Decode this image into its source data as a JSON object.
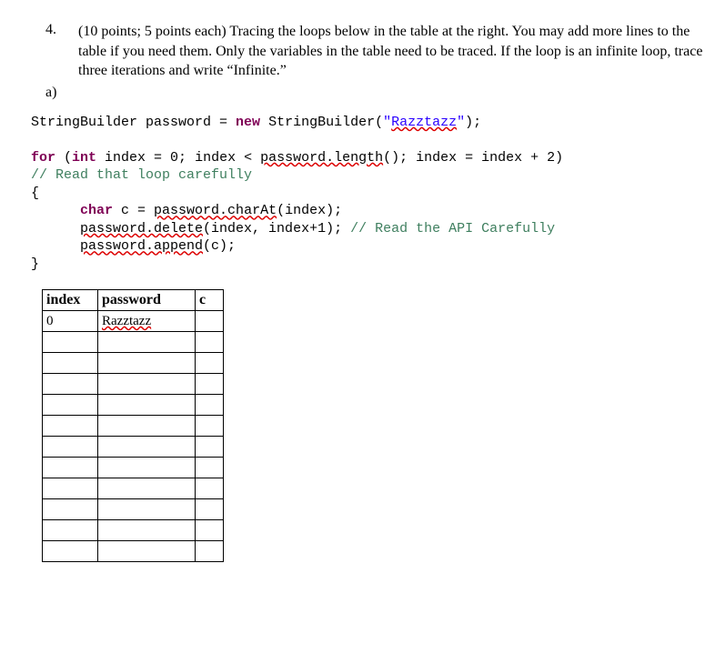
{
  "question": {
    "number": "4.",
    "prompt": "(10 points; 5 points each) Tracing the loops below in the table at the right. You may add more lines to the table if you need them.  Only the variables in the table need to be traced. If the loop is an infinite loop, trace three iterations and write “Infinite.”",
    "part": "a)"
  },
  "code": {
    "line1_a": "StringBuilder password = ",
    "line1_kw": "new",
    "line1_b": " StringBuilder(",
    "line1_str_open": "\"",
    "line1_str_text": "Razztazz",
    "line1_str_close": "\"",
    "line1_c": ");",
    "line2_kw1": "for",
    "line2_a": " (",
    "line2_kw2": "int",
    "line2_b": " index = 0; index < ",
    "line2_sq": "password.length",
    "line2_c": "(); index = index + 2)",
    "line3_cmnt": "// Read that loop carefully",
    "line4": "{",
    "line5_indent": "      ",
    "line5_kw": "char",
    "line5_a": " c = ",
    "line5_sq": "password.charAt",
    "line5_b": "(index);",
    "line6_indent": "      ",
    "line6_sq": "password.delete",
    "line6_a": "(index, index+1); ",
    "line6_cmnt": "// Read the API Carefully",
    "line7_indent": "      ",
    "line7_sq": "password.append",
    "line7_a": "(c);",
    "line8": "}"
  },
  "table": {
    "headers": {
      "index": "index",
      "password": "password",
      "c": "c"
    },
    "rows": [
      {
        "index": "0",
        "password": "Razztazz",
        "c": ""
      },
      {
        "index": "",
        "password": "",
        "c": ""
      },
      {
        "index": "",
        "password": "",
        "c": ""
      },
      {
        "index": "",
        "password": "",
        "c": ""
      },
      {
        "index": "",
        "password": "",
        "c": ""
      },
      {
        "index": "",
        "password": "",
        "c": ""
      },
      {
        "index": "",
        "password": "",
        "c": ""
      },
      {
        "index": "",
        "password": "",
        "c": ""
      },
      {
        "index": "",
        "password": "",
        "c": ""
      },
      {
        "index": "",
        "password": "",
        "c": ""
      },
      {
        "index": "",
        "password": "",
        "c": ""
      },
      {
        "index": "",
        "password": "",
        "c": ""
      }
    ]
  }
}
